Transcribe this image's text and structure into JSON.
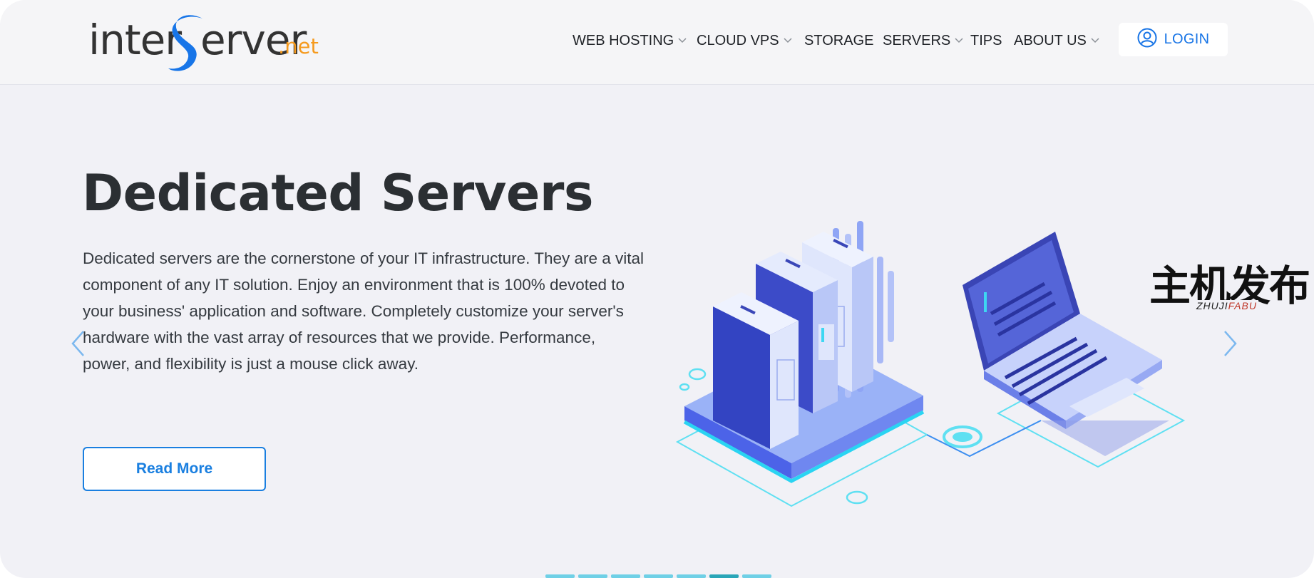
{
  "brand": {
    "logo_part1": "inter",
    "logo_part2": "erver",
    "logo_suffix": ".net",
    "accent_color": "#f59a1e",
    "s_color": "#1775e8"
  },
  "nav": {
    "items": [
      {
        "label": "WEB HOSTING",
        "dropdown": true
      },
      {
        "label": "CLOUD VPS",
        "dropdown": true
      },
      {
        "label": "STORAGE",
        "dropdown": false
      },
      {
        "label": "SERVERS",
        "dropdown": true
      },
      {
        "label": "TIPS",
        "dropdown": false
      },
      {
        "label": "ABOUT US",
        "dropdown": true
      }
    ],
    "login_label": "LOGIN",
    "login_icon": "user-circle-icon"
  },
  "hero": {
    "title": "Dedicated Servers",
    "description": "Dedicated servers are the cornerstone of your IT infrastructure. They are a vital component of any IT solution. Enjoy an environment that is 100% devoted to your business' application and software. Completely customize your server's hardware with the vast array of resources that we provide. Performance, power, and flexibility is just a mouse click away.",
    "cta_label": "Read More",
    "prev_icon": "chevron-left-icon",
    "next_icon": "chevron-right-icon"
  },
  "watermark": {
    "chinese": "主机发布",
    "latin_part1": "ZHUJI",
    "latin_part2": "FABU"
  },
  "colors": {
    "primary": "#1a7fe0",
    "title": "#2b2f33",
    "background": "#f1f1f6"
  }
}
